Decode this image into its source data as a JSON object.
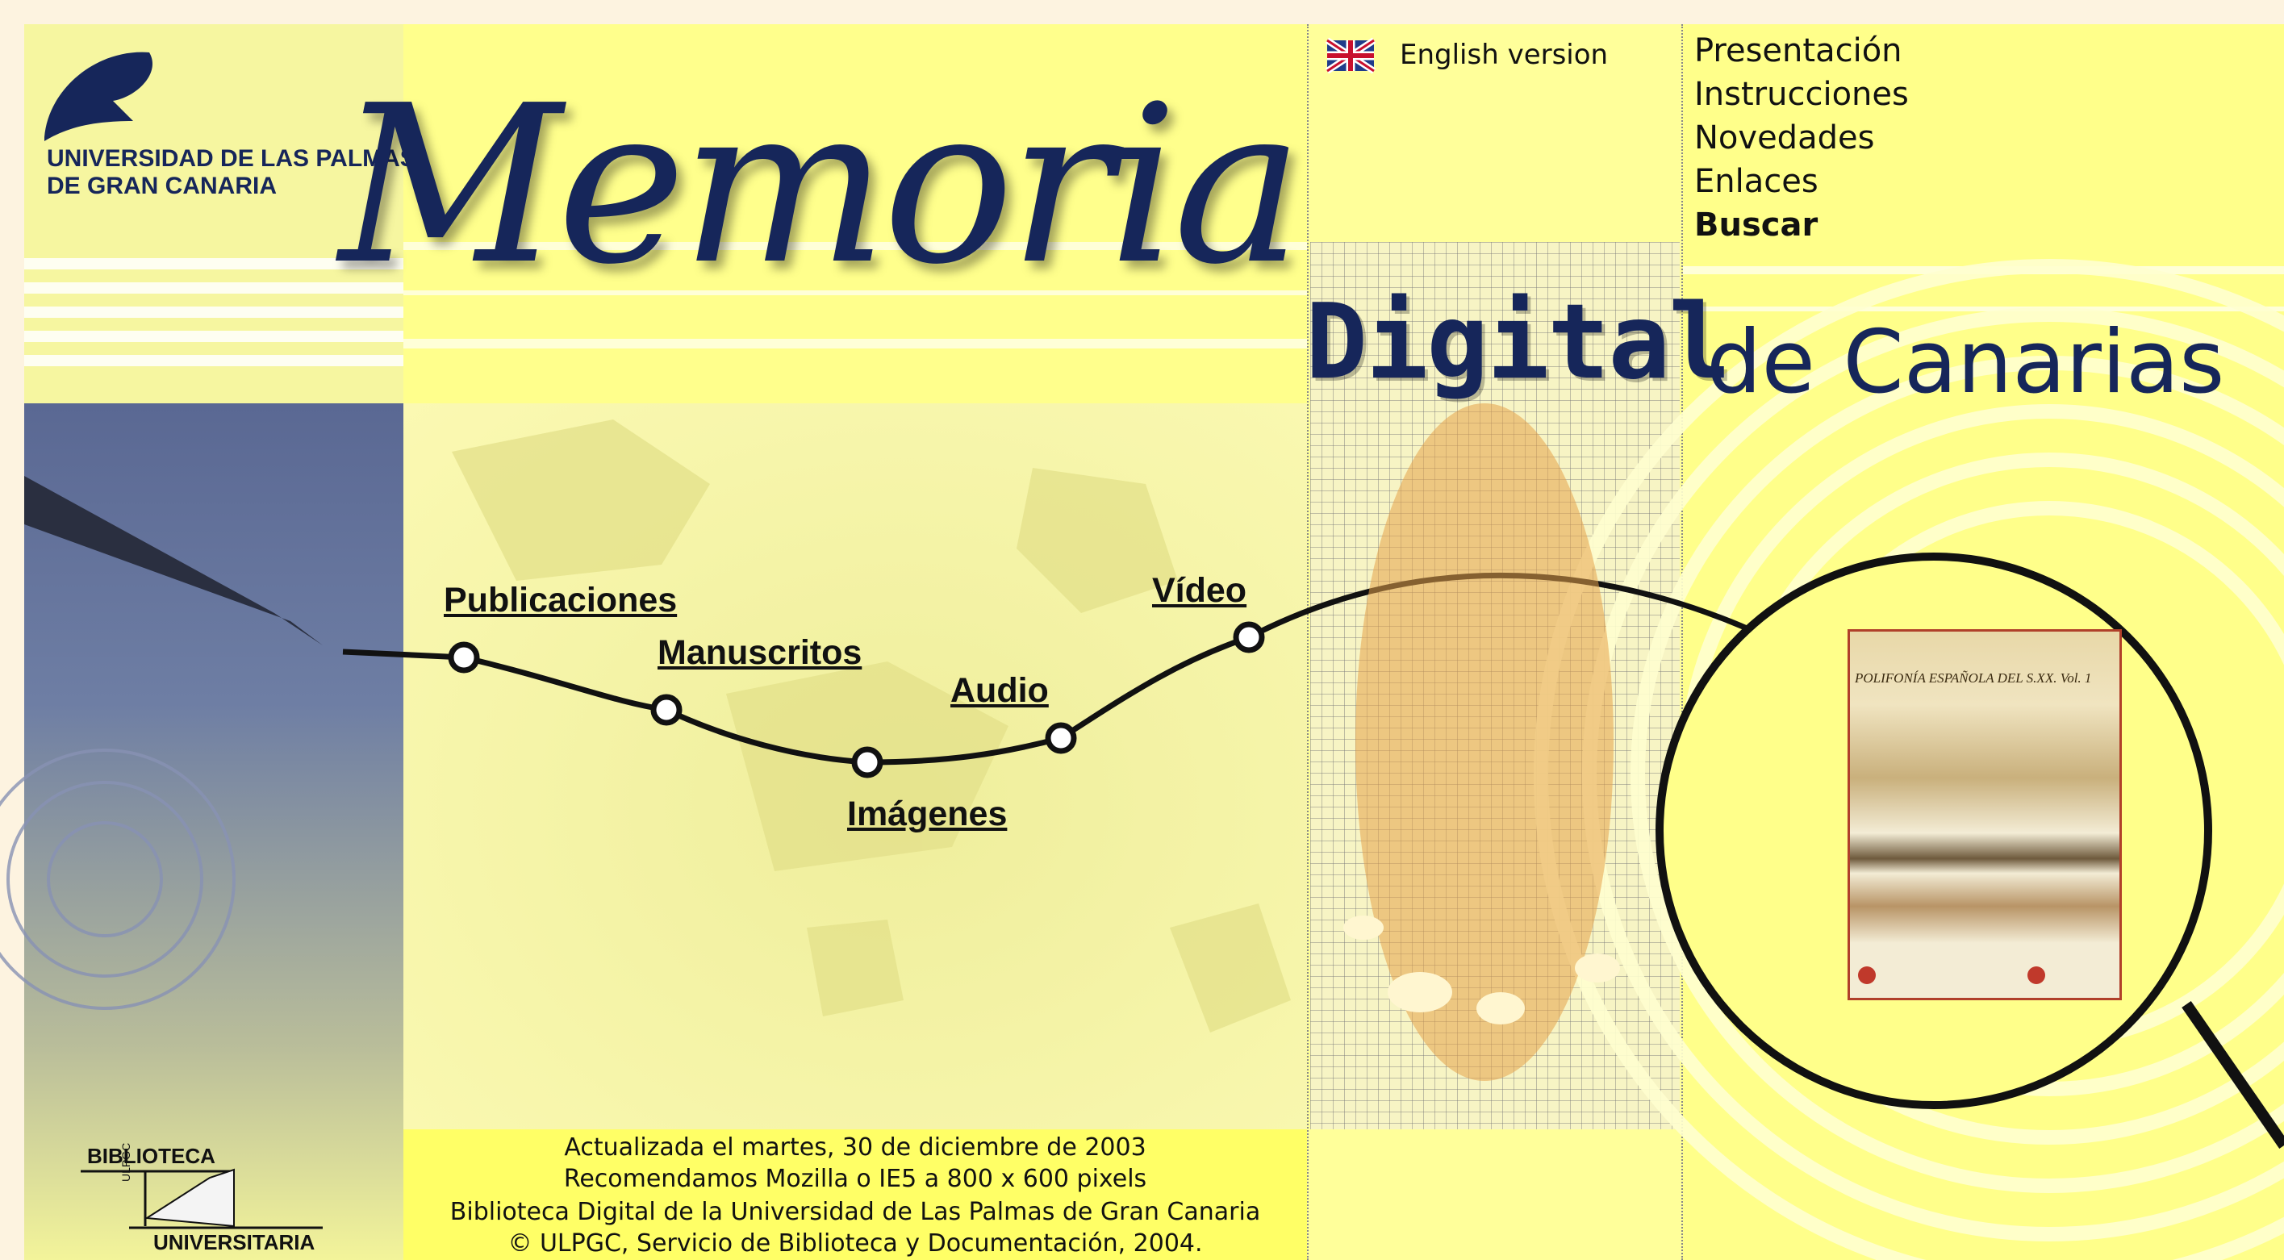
{
  "university": {
    "line1": "UNIVERSIDAD DE LAS PALMAS",
    "line2": "DE GRAN CANARIA"
  },
  "title": {
    "script": "Memoria",
    "digital": "Digital",
    "rest": "de Canarias"
  },
  "english_link": "English version",
  "menu": [
    {
      "label": "Presentación",
      "bold": false
    },
    {
      "label": "Instrucciones",
      "bold": false
    },
    {
      "label": "Novedades",
      "bold": false
    },
    {
      "label": "Enlaces",
      "bold": false
    },
    {
      "label": "Buscar",
      "bold": true
    }
  ],
  "timeline": {
    "publicaciones": "Publicaciones",
    "manuscritos": "Manuscritos",
    "imagenes": "Imágenes",
    "audio": "Audio",
    "video": "Vídeo"
  },
  "cover": {
    "title": "POLIFONÍA ESPAÑOLA DEL S.XX. Vol. 1"
  },
  "library_logo": {
    "top": "BIBLIOTECA",
    "side": "ULPGC",
    "bottom": "UNIVERSITARIA"
  },
  "footer": {
    "line1": "Actualizada el martes, 30 de diciembre de 2003",
    "line2": "Recomendamos Mozilla o IE5 a 800 x 600 pixels",
    "line3": "Biblioteca Digital de la Universidad de Las Palmas de Gran Canaria",
    "line4": "© ULPGC, Servicio de Biblioteca y Documentación, 2004."
  },
  "colors": {
    "navy": "#16265a",
    "yellow": "#ffff8c",
    "slate": "#5a6893"
  }
}
